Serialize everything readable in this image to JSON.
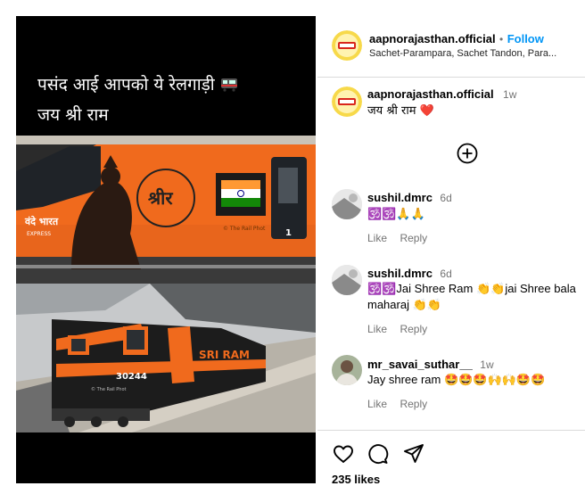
{
  "post": {
    "overlay_line1": "पसंद आई आपको ये रेलगाड़ी",
    "overlay_line2": "जय श्री राम",
    "train_top_text": "श्रीर",
    "train_top_brand": "वंदे भारत",
    "train_top_brand_sub": "EXPRESS",
    "train_top_watermark": "© The Rail Phot",
    "train_top_number": "1",
    "train_bottom_text": "SRI RAM",
    "train_bottom_number": "30244",
    "train_bottom_watermark": "© The Rail Phot"
  },
  "header": {
    "username": "aapnorajasthan.official",
    "separator": "•",
    "follow_label": "Follow",
    "audio": "Sachet-Parampara, Sachet Tandon, Para..."
  },
  "caption": {
    "username": "aapnorajasthan.official",
    "age": "1w",
    "text": "जय श्री राम",
    "heart": "❤️"
  },
  "more_comments_icon": "plus-circle-icon",
  "comments": [
    {
      "username": "sushil.dmrc",
      "age": "6d",
      "line1": "🕉️🕉️🙏🙏",
      "line2": "",
      "like": "Like",
      "reply": "Reply"
    },
    {
      "username": "sushil.dmrc",
      "age": "6d",
      "line1": "🕉️🕉️Jai Shree Ram 👏👏jai Shree bala",
      "line2": "maharaj 👏👏",
      "like": "Like",
      "reply": "Reply"
    },
    {
      "username": "mr_savai_suthar__",
      "age": "1w",
      "line1": "Jay shree ram 🤩🤩🤩🙌🙌🤩🤩",
      "line2": "",
      "like": "Like",
      "reply": "Reply"
    }
  ],
  "actions": {
    "like_icon": "heart-icon",
    "comment_icon": "comment-icon",
    "share_icon": "send-icon",
    "likes_text": "235 likes"
  },
  "colors": {
    "follow_blue": "#0095f6",
    "train_orange": "#f06a1d",
    "heart_red": "#ed4956"
  }
}
